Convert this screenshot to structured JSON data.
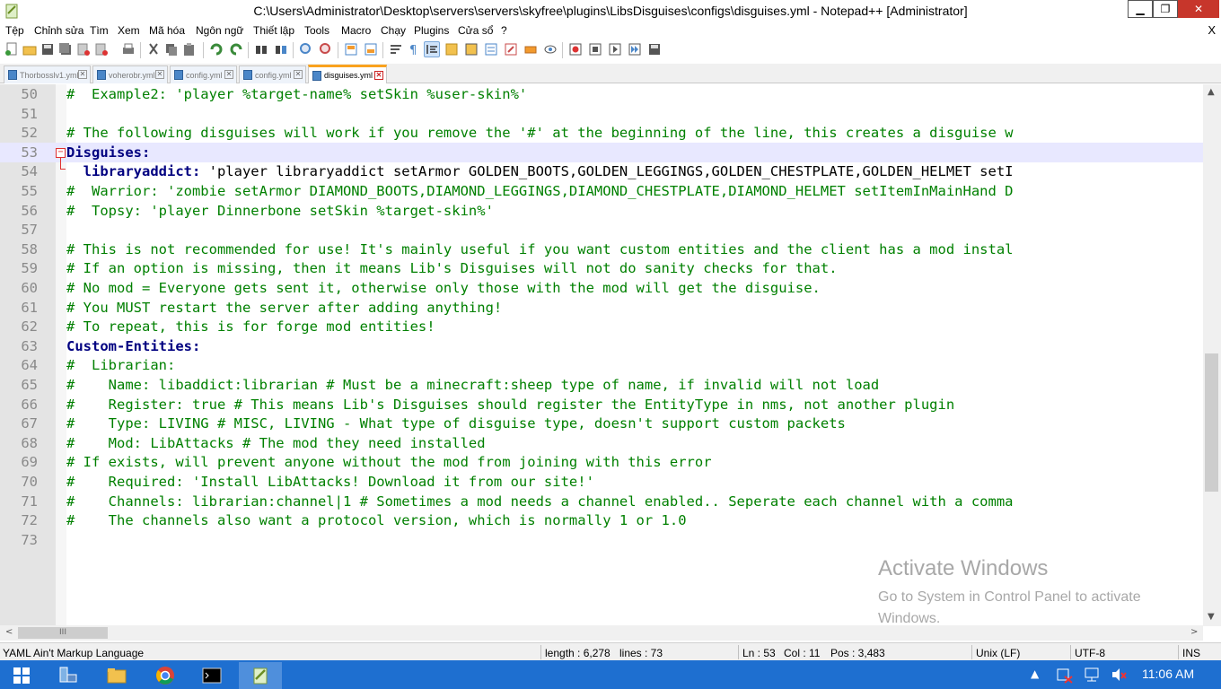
{
  "window": {
    "title": "C:\\Users\\Administrator\\Desktop\\servers\\servers\\skyfree\\plugins\\LibsDisguises\\configs\\disguises.yml - Notepad++ [Administrator]",
    "minimize": "▁",
    "maximize": "❐",
    "close": "✕"
  },
  "menu": [
    "Tệp",
    "Chỉnh sửa",
    "Tìm",
    "Xem",
    "Mã hóa",
    "Ngôn ngữ",
    "Thiết lập",
    "Tools",
    "Macro",
    "Chạy",
    "Plugins",
    "Cửa sổ",
    "?"
  ],
  "menu_close": "X",
  "tabs": [
    {
      "label": "Thorbosslv1.yml"
    },
    {
      "label": "voherobr.yml"
    },
    {
      "label": "config.yml"
    },
    {
      "label": "config.yml"
    },
    {
      "label": "disguises.yml",
      "active": true
    }
  ],
  "editor": {
    "lines": [
      {
        "n": "50",
        "segments": [
          {
            "t": "#  Example2: 'player %target-name% setSkin %user-skin%'",
            "c": "comment"
          }
        ]
      },
      {
        "n": "51",
        "segments": []
      },
      {
        "n": "52",
        "segments": [
          {
            "t": "# The following disguises will work if you remove the '#' at the beginning of the line, this creates a disguise w",
            "c": "comment"
          }
        ]
      },
      {
        "n": "53",
        "current": true,
        "fold": true,
        "segments": [
          {
            "t": "Disguises:",
            "c": "key"
          }
        ]
      },
      {
        "n": "54",
        "segments": [
          {
            "t": "  libraryaddict:",
            "c": "key"
          },
          {
            "t": " 'player libraryaddict setArmor GOLDEN_BOOTS,GOLDEN_LEGGINGS,GOLDEN_CHESTPLATE,GOLDEN_HELMET setI",
            "c": "plain"
          }
        ]
      },
      {
        "n": "55",
        "segments": [
          {
            "t": "#  Warrior: 'zombie setArmor DIAMOND_BOOTS,DIAMOND_LEGGINGS,DIAMOND_CHESTPLATE,DIAMOND_HELMET setItemInMainHand D",
            "c": "comment"
          }
        ]
      },
      {
        "n": "56",
        "segments": [
          {
            "t": "#  Topsy: 'player Dinnerbone setSkin %target-skin%'",
            "c": "comment"
          }
        ]
      },
      {
        "n": "57",
        "segments": []
      },
      {
        "n": "58",
        "segments": [
          {
            "t": "# This is not recommended for use! It's mainly useful if you want custom entities and the client has a mod instal",
            "c": "comment"
          }
        ]
      },
      {
        "n": "59",
        "segments": [
          {
            "t": "# If an option is missing, then it means Lib's Disguises will not do sanity checks for that.",
            "c": "comment"
          }
        ]
      },
      {
        "n": "60",
        "segments": [
          {
            "t": "# No mod = Everyone gets sent it, otherwise only those with the mod will get the disguise.",
            "c": "comment"
          }
        ]
      },
      {
        "n": "61",
        "segments": [
          {
            "t": "# You MUST restart the server after adding anything!",
            "c": "comment"
          }
        ]
      },
      {
        "n": "62",
        "segments": [
          {
            "t": "# To repeat, this is for forge mod entities!",
            "c": "comment"
          }
        ]
      },
      {
        "n": "63",
        "segments": [
          {
            "t": "Custom-Entities:",
            "c": "key"
          }
        ]
      },
      {
        "n": "64",
        "segments": [
          {
            "t": "#  Librarian:",
            "c": "comment"
          }
        ]
      },
      {
        "n": "65",
        "segments": [
          {
            "t": "#    Name: libaddict:librarian # Must be a minecraft:sheep type of name, if invalid will not load",
            "c": "comment"
          }
        ]
      },
      {
        "n": "66",
        "segments": [
          {
            "t": "#    Register: true # This means Lib's Disguises should register the EntityType in nms, not another plugin",
            "c": "comment"
          }
        ]
      },
      {
        "n": "67",
        "segments": [
          {
            "t": "#    Type: LIVING # MISC, LIVING - What type of disguise type, doesn't support custom packets",
            "c": "comment"
          }
        ]
      },
      {
        "n": "68",
        "segments": [
          {
            "t": "#    Mod: LibAttacks # The mod they need installed",
            "c": "comment"
          }
        ]
      },
      {
        "n": "69",
        "segments": [
          {
            "t": "# If exists, will prevent anyone without the mod from joining with this error",
            "c": "comment"
          }
        ]
      },
      {
        "n": "70",
        "segments": [
          {
            "t": "#    Required: 'Install LibAttacks! Download it from our site!'",
            "c": "comment"
          }
        ]
      },
      {
        "n": "71",
        "segments": [
          {
            "t": "#    Channels: librarian:channel|1 # Sometimes a mod needs a channel enabled.. Seperate each channel with a comma",
            "c": "comment"
          }
        ]
      },
      {
        "n": "72",
        "segments": [
          {
            "t": "#    The channels also want a protocol version, which is normally 1 or 1.0",
            "c": "comment"
          }
        ]
      },
      {
        "n": "73",
        "segments": []
      }
    ]
  },
  "scroll": {
    "hthumb_grip": "III",
    "up": "▲",
    "down": "▼",
    "left": "<",
    "right": ">"
  },
  "watermark": {
    "title": "Activate Windows",
    "subtitle": "Go to System in Control Panel to activate Windows."
  },
  "status": {
    "language": "YAML Ain't Markup Language",
    "length": "length : 6,278",
    "lines": "lines : 73",
    "ln": "Ln : 53",
    "col": "Col : 11",
    "pos": "Pos : 3,483",
    "eol": "Unix (LF)",
    "encoding": "UTF-8",
    "mode": "INS"
  },
  "taskbar": {
    "clock": "11:06 AM",
    "tray_up": "▲"
  },
  "colors": {
    "comment": "#008000",
    "key": "#000080",
    "taskbar": "#1e6fd0",
    "active_tab_accent": "#f9a21e"
  }
}
